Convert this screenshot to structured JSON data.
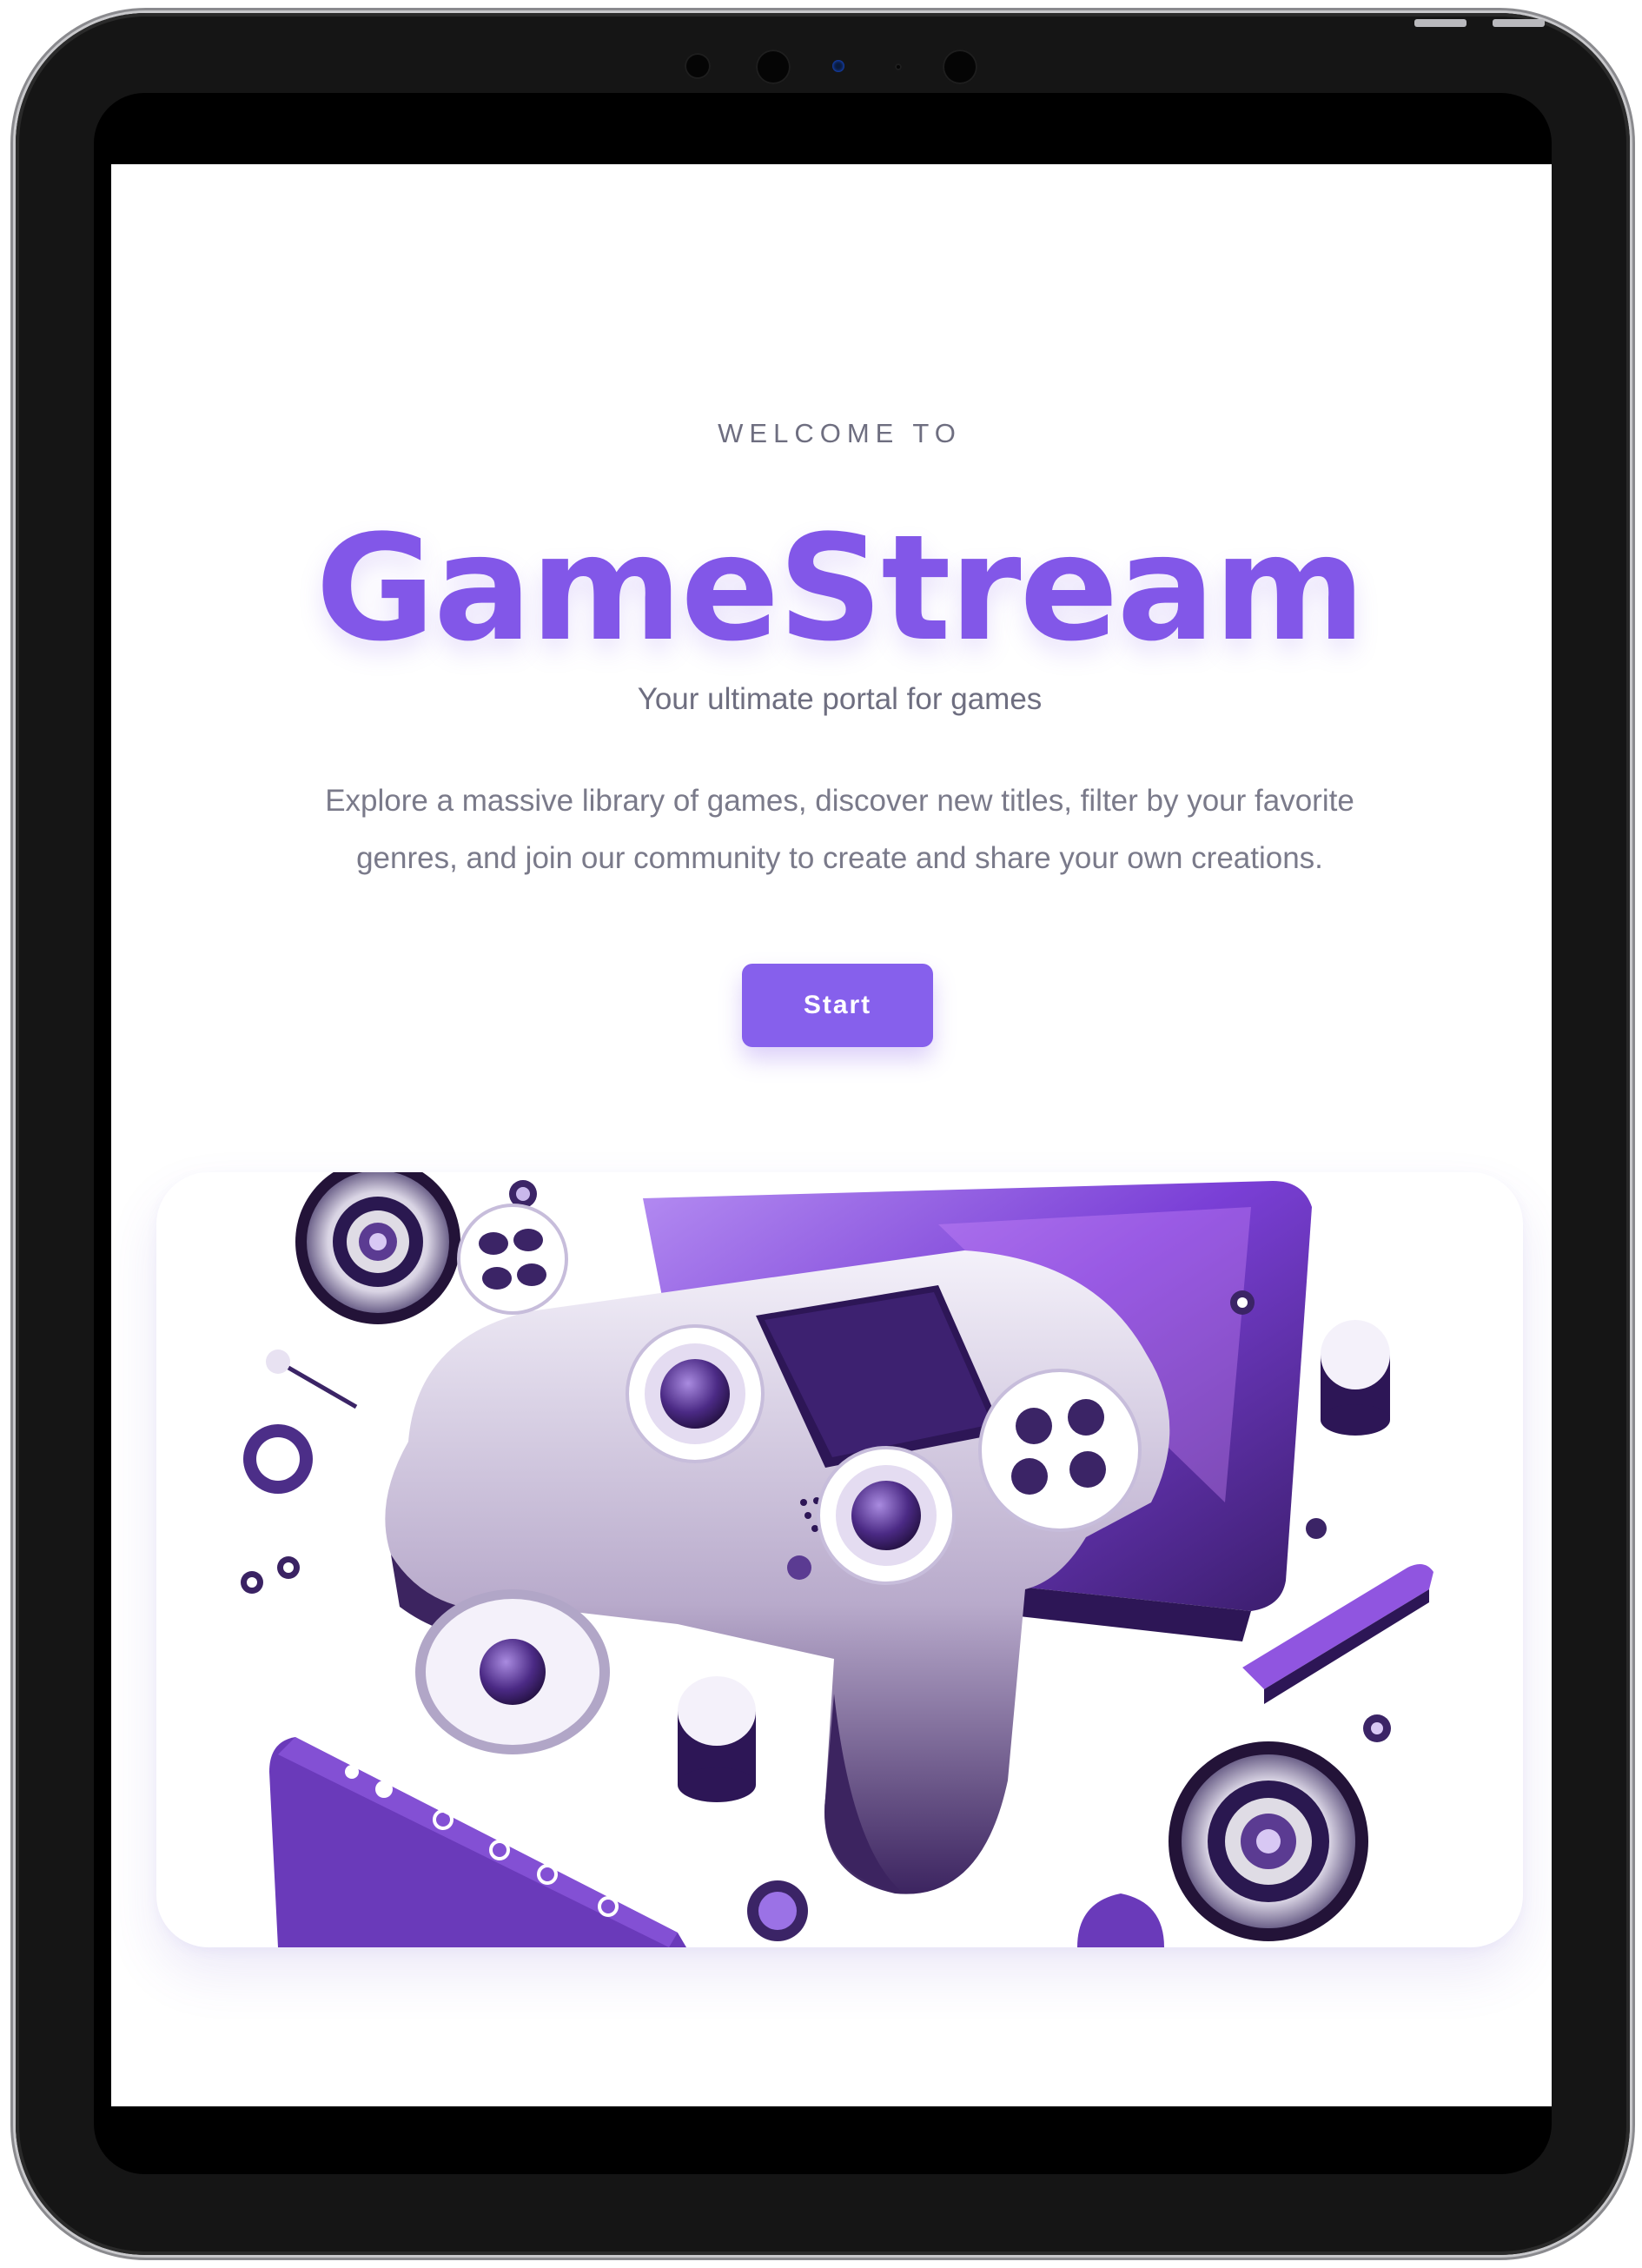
{
  "hero": {
    "eyebrow": "WELCOME TO",
    "brand": "GameStream",
    "tagline": "Your ultimate portal for games",
    "description": "Explore a massive library of games, discover new titles, filter by your favorite genres, and join our community to create and share your own creations.",
    "start_label": "Start"
  },
  "illustration": {
    "icon": "gamepad-illustration",
    "accent_color": "#8257e8",
    "dark_color": "#2a1850"
  },
  "colors": {
    "brand": "#8257e8",
    "button": "#8660ec",
    "muted_text": "#6e6e80"
  }
}
